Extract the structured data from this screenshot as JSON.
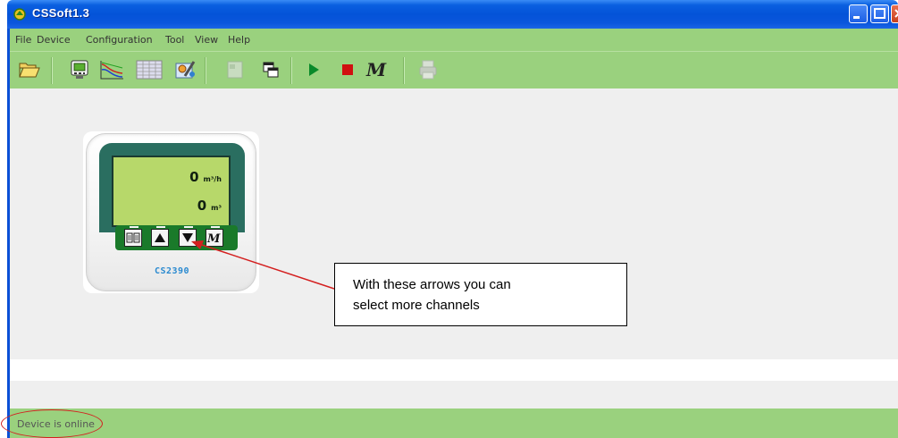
{
  "window": {
    "title": "CSSoft1.3"
  },
  "menu": {
    "items": [
      "File",
      "Device",
      "Configuration",
      "Tool",
      "View",
      "Help"
    ]
  },
  "toolbar": {
    "buttons": [
      {
        "name": "open-folder",
        "icon": "folder-open-icon",
        "enabled": true
      },
      {
        "name": "device-view",
        "icon": "monitor-icon",
        "enabled": true
      },
      {
        "name": "chart-view",
        "icon": "line-chart-icon",
        "enabled": true
      },
      {
        "name": "table-view",
        "icon": "table-icon",
        "enabled": true
      },
      {
        "name": "settings",
        "icon": "config-tools-icon",
        "enabled": true
      },
      {
        "name": "disabled-tool",
        "icon": "window-disabled-icon",
        "enabled": false
      },
      {
        "name": "windows",
        "icon": "cascade-windows-icon",
        "enabled": true
      },
      {
        "name": "start",
        "icon": "play-icon",
        "enabled": true
      },
      {
        "name": "stop",
        "icon": "stop-icon",
        "enabled": true
      },
      {
        "name": "m-mode",
        "icon": "m-script-icon",
        "enabled": true
      },
      {
        "name": "print",
        "icon": "printer-icon",
        "enabled": false
      }
    ]
  },
  "device": {
    "model": "CS2390",
    "readings": [
      {
        "value": "0",
        "unit": "m³/h"
      },
      {
        "value": "0",
        "unit": "m³"
      }
    ],
    "keys": [
      "book-icon",
      "arrow-up-icon",
      "arrow-down-icon",
      "m-key-icon"
    ]
  },
  "annotation": {
    "line1": "With these arrows you can",
    "line2": "select more channels"
  },
  "status": {
    "text": "Device is online"
  },
  "colors": {
    "title_bar": "#0453d8",
    "toolbar_bg": "#9ad17e",
    "content_bg": "#efefef",
    "annotation_red": "#d42020",
    "lcd_bg": "#b7d86a",
    "keypad_bg": "#1a7a2a"
  }
}
